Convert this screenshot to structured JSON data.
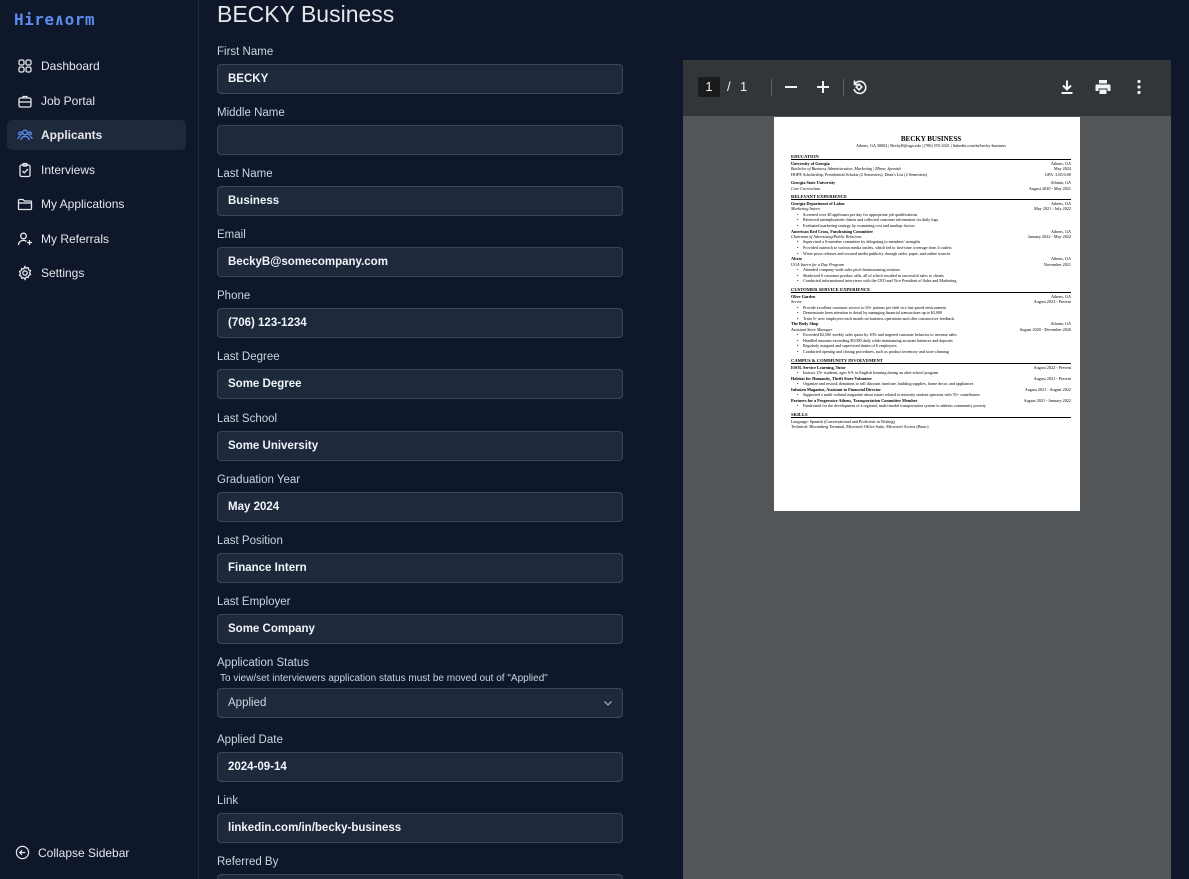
{
  "app": {
    "logo": "Hire∧orm"
  },
  "sidebar": {
    "items": [
      {
        "label": "Dashboard",
        "icon": "grid-icon"
      },
      {
        "label": "Job Portal",
        "icon": "briefcase-icon"
      },
      {
        "label": "Applicants",
        "icon": "users-icon",
        "active": true
      },
      {
        "label": "Interviews",
        "icon": "clipboard-icon"
      },
      {
        "label": "My Applications",
        "icon": "folder-icon"
      },
      {
        "label": "My Referrals",
        "icon": "user-plus-icon"
      },
      {
        "label": "Settings",
        "icon": "gear-icon"
      }
    ],
    "collapse_label": "Collapse Sidebar"
  },
  "form": {
    "title": "BECKY Business",
    "first_name": {
      "label": "First Name",
      "value": "BECKY"
    },
    "middle_name": {
      "label": "Middle Name",
      "value": ""
    },
    "last_name": {
      "label": "Last Name",
      "value": "Business"
    },
    "email": {
      "label": "Email",
      "value": "BeckyB@somecompany.com"
    },
    "phone": {
      "label": "Phone",
      "value": "(706) 123-1234"
    },
    "last_degree": {
      "label": "Last Degree",
      "value": "Some Degree"
    },
    "last_school": {
      "label": "Last School",
      "value": "Some University"
    },
    "graduation_year": {
      "label": "Graduation Year",
      "value": "May 2024"
    },
    "last_position": {
      "label": "Last Position",
      "value": "Finance Intern"
    },
    "last_employer": {
      "label": "Last Employer",
      "value": "Some Company"
    },
    "application_status": {
      "label": "Application Status",
      "hint": "To view/set interviewers application status must be moved out of \"Applied\"",
      "value": "Applied"
    },
    "applied_date": {
      "label": "Applied Date",
      "value": "2024-09-14"
    },
    "link": {
      "label": "Link",
      "value": "linkedin.com/in/becky-business"
    },
    "referred_by": {
      "label": "Referred By"
    }
  },
  "pdf": {
    "current_page": "1",
    "separator": "/",
    "total_pages": "1",
    "resume": {
      "name": "BECKY BUSINESS",
      "contact": "Athens, GA 30602 | BeckyB@uga.edu | (706) 555-4321 | linkedin.com/in/becky-business",
      "sections": [
        {
          "title": "EDUCATION",
          "lines": [
            {
              "t": "row",
              "l": "University of Georgia",
              "lc": "b",
              "r": "Athens, GA"
            },
            {
              "t": "row",
              "l": "Bachelor of Business Administration, Marketing | Minor, Spanish",
              "lc": "i",
              "r": "May 2024"
            },
            {
              "t": "row",
              "l": "HOPE Scholarship, Presidential Scholar (2 Semesters), Dean's List (2 Semesters)",
              "lc": "",
              "r": "GPA: 3.65/4.00"
            },
            {
              "t": "gap"
            },
            {
              "t": "row",
              "l": "Georgia State University",
              "lc": "b",
              "r": "Atlanta, GA"
            },
            {
              "t": "row",
              "l": "Core Curriculum",
              "lc": "i",
              "r": "August 2020 - May 2021"
            }
          ]
        },
        {
          "title": "RELEVANT EXPERIENCE",
          "lines": [
            {
              "t": "row",
              "l": "Georgia Department of Labor",
              "lc": "b",
              "r": "Athens, GA"
            },
            {
              "t": "row",
              "l": "Marketing Intern",
              "lc": "i",
              "r": "May 2021 - July 2022"
            },
            {
              "t": "bul",
              "l": "Screened over 40 applicants per day for appropriate job qualifications"
            },
            {
              "t": "bul",
              "l": "Retrieved unemployment claims and collected customer information for daily logs"
            },
            {
              "t": "bul",
              "l": "Evaluated marketing strategy by examining cost and markup factors"
            },
            {
              "t": "row",
              "l": "American Red Cross, Fundraising Committee",
              "lc": "b",
              "r": "Athens, GA"
            },
            {
              "t": "row",
              "l": "Chairman of Advertising/Public Relations",
              "lc": "i",
              "r": "January 2022 - May 2022"
            },
            {
              "t": "bul",
              "l": "Supervised a 6-member committee by delegating to members' strengths"
            },
            {
              "t": "bul",
              "l": "Provided outreach to various media outlets, which led to first-time coverage from 4 outlets"
            },
            {
              "t": "bul",
              "l": "Wrote press releases and secured media publicity through radio, paper, and online sources"
            },
            {
              "t": "row",
              "l": "Altria",
              "lc": "b",
              "r": "Athens, GA"
            },
            {
              "t": "row",
              "l": "UGA Intern for a Day Program",
              "lc": "i",
              "r": "November 2021"
            },
            {
              "t": "bul",
              "l": "Attended company-wide sales pitch brainstorming sessions"
            },
            {
              "t": "bul",
              "l": "Shadowed 6 customer product calls, all of which resulted in successful sales to clients"
            },
            {
              "t": "bul",
              "l": "Conducted informational interviews with the CEO and Vice President of Sales and Marketing"
            }
          ]
        },
        {
          "title": "CUSTOMER SERVICE EXPERIENCE",
          "lines": [
            {
              "t": "row",
              "l": "Olive Garden",
              "lc": "b",
              "r": "Athens, GA"
            },
            {
              "t": "row",
              "l": "Server",
              "lc": "i",
              "r": "August 2021 - Present"
            },
            {
              "t": "bul",
              "l": "Provide excellent customer service to 50+ patrons per shift in a fast-paced environment"
            },
            {
              "t": "bul",
              "l": "Demonstrate keen attention to detail by managing financial transactions up to $2,000"
            },
            {
              "t": "bul",
              "l": "Train 5+ new employees each month on business operations and offer constructive feedback"
            },
            {
              "t": "row",
              "l": "The Body Shop",
              "lc": "b",
              "r": "Atlanta, GA"
            },
            {
              "t": "row",
              "l": "Assistant Store Manager",
              "lc": "i",
              "r": "August 2020 - December 2020"
            },
            {
              "t": "bul",
              "l": "Exceeded $2,500 weekly sales quota by 10% and targeted customer behavior to increase sales"
            },
            {
              "t": "bul",
              "l": "Handled amounts exceeding $5,000 daily while maintaining accurate balances and deposits"
            },
            {
              "t": "bul",
              "l": "Regularly assigned and supervised duties of 6 employees"
            },
            {
              "t": "bul",
              "l": "Conducted opening and closing procedures, such as product inventory and store cleaning"
            }
          ]
        },
        {
          "title": "CAMPUS & COMMUNITY INVOLVEMENT",
          "lines": [
            {
              "t": "row",
              "l": "ESOL Service Learning, Tutor",
              "lc": "b",
              "r": "August 2022 - Present"
            },
            {
              "t": "bul",
              "l": "Instruct 10+ students, ages 6-9, in English learning during an after-school program"
            },
            {
              "t": "row",
              "l": "Habitat for Humanity, Thrift Store Volunteer",
              "lc": "b",
              "r": "August 2021 - Present"
            },
            {
              "t": "bul",
              "l": "Organize and restock donations to sell discount furniture, building supplies, home decor, and appliances"
            },
            {
              "t": "row",
              "l": "Infusion Magazine, Assistant to Financial Director",
              "lc": "b",
              "r": "August 2021 - August 2022"
            },
            {
              "t": "bul",
              "l": "Supported a multi-cultural magazine about issues related to minority student opinions with 55+ contributors"
            },
            {
              "t": "row",
              "l": "Partners for a Progressive Athens, Transportation Committee Member",
              "lc": "b",
              "r": "August 2021 - January 2022"
            },
            {
              "t": "bul",
              "l": "Fundraised for the development of a regional, multi-modal transportation system to address community poverty"
            }
          ]
        },
        {
          "title": "SKILLS",
          "lines": [
            {
              "t": "row",
              "l": "Language: Spanish (Conversational and Proficient in Writing)",
              "lc": "",
              "r": ""
            },
            {
              "t": "row",
              "l": "Technical: Bloomberg Terminal, Microsoft Office Suite, Microsoft Access (Basic)",
              "lc": "",
              "r": ""
            }
          ]
        }
      ]
    }
  },
  "colors": {
    "accent": "#5b8def",
    "bg": "#0f172a",
    "input_bg": "#1e293b",
    "viewer_bg": "#525659",
    "toolbar_bg": "#323639"
  }
}
